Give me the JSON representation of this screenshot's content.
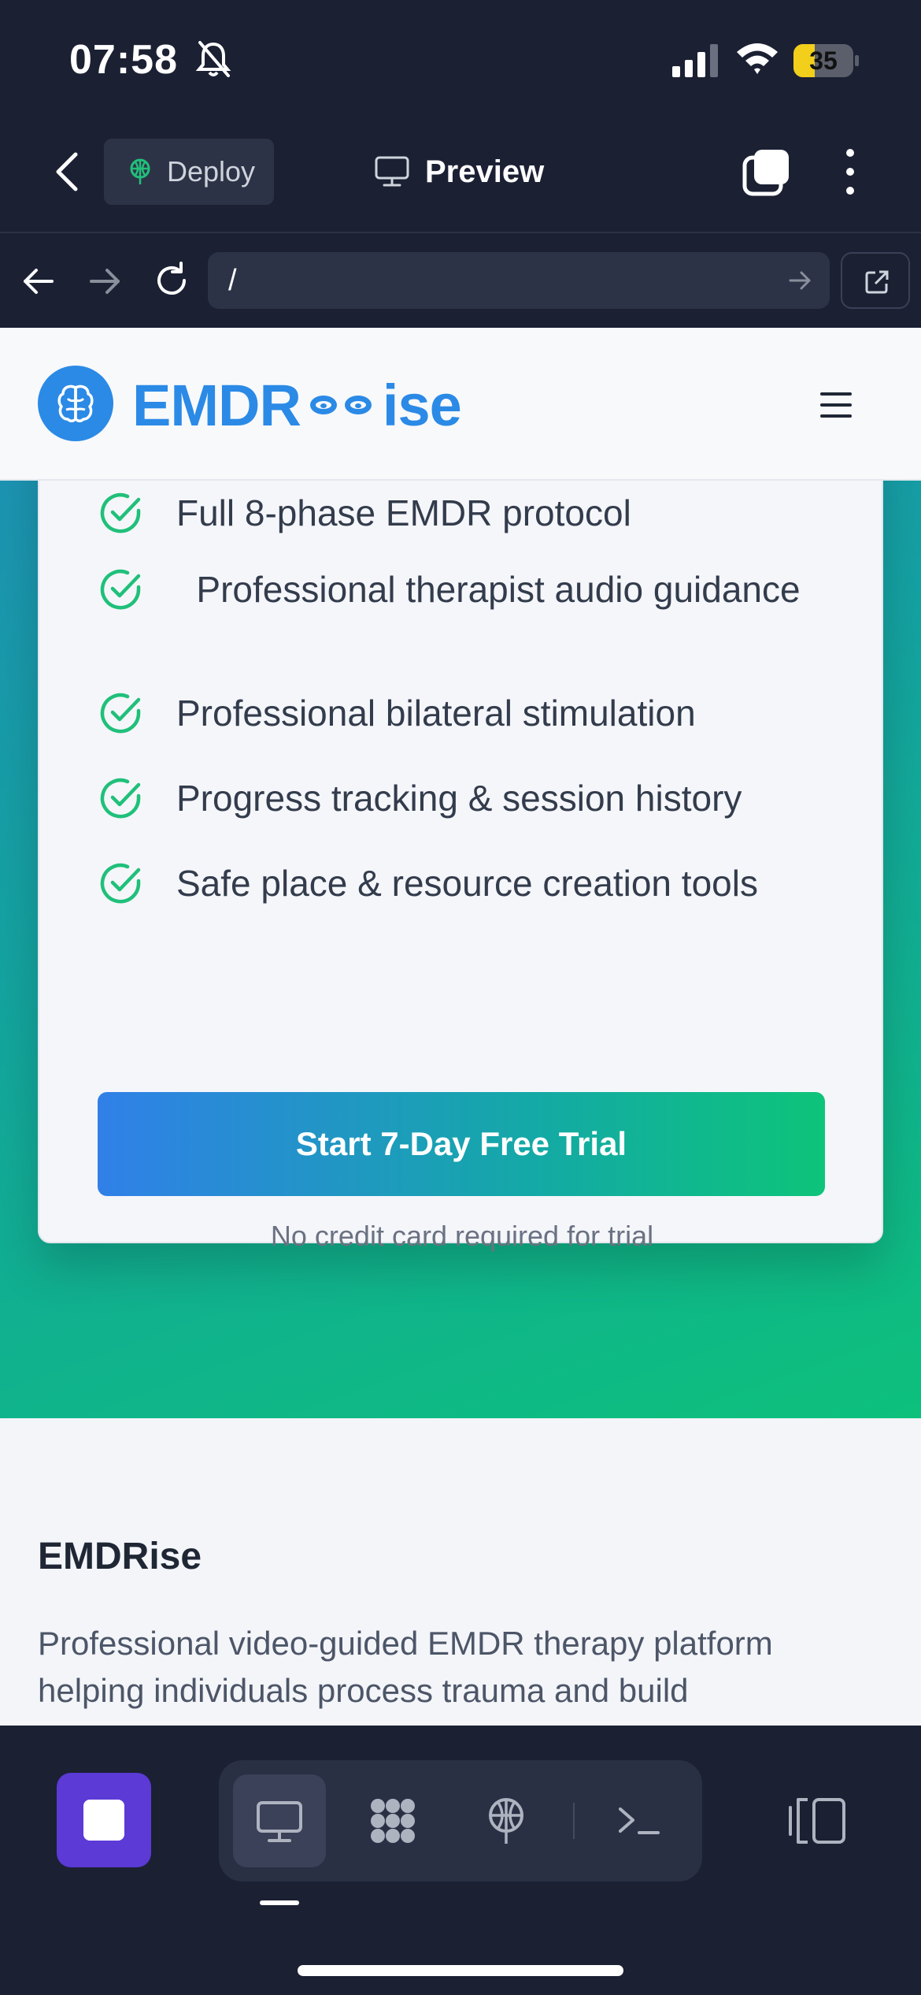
{
  "status_bar": {
    "time": "07:58",
    "battery_level": "35",
    "battery_fraction": 0.35
  },
  "app_bar": {
    "deploy_label": "Deploy",
    "preview_label": "Preview"
  },
  "browser": {
    "url": "/"
  },
  "site": {
    "logo": {
      "part1": "EMDR",
      "part2": "ise"
    },
    "features": [
      "Full 8-phase EMDR protocol",
      "Professional therapist audio guidance",
      "Professional bilateral stimulation",
      "Progress tracking & session history",
      "Safe place & resource creation tools"
    ],
    "cta_label": "Start 7-Day Free Trial",
    "trial_note": "No credit card required for trial",
    "footer": {
      "title": "EMDRise",
      "description": "Professional video-guided EMDR therapy platform helping individuals process trauma and build"
    }
  },
  "colors": {
    "brand_blue": "#2b8ae6",
    "check_green": "#20c07a",
    "gradient_start": "#3080e8",
    "gradient_end": "#0dc47a",
    "stop_purple": "#5b3ad6"
  },
  "icons": {
    "status": [
      "bell-slash-icon",
      "signal-icon",
      "wifi-icon",
      "battery-icon"
    ],
    "toolbar": [
      "chevron-left-icon",
      "deploy-icon",
      "monitor-icon",
      "tabs-icon",
      "more-vertical-icon"
    ],
    "browser": [
      "arrow-left-icon",
      "arrow-right-icon",
      "reload-icon",
      "external-link-icon"
    ],
    "bottom": [
      "stop-icon",
      "monitor-icon",
      "grid-icon",
      "deploy-icon",
      "terminal-icon",
      "panel-icon"
    ]
  }
}
